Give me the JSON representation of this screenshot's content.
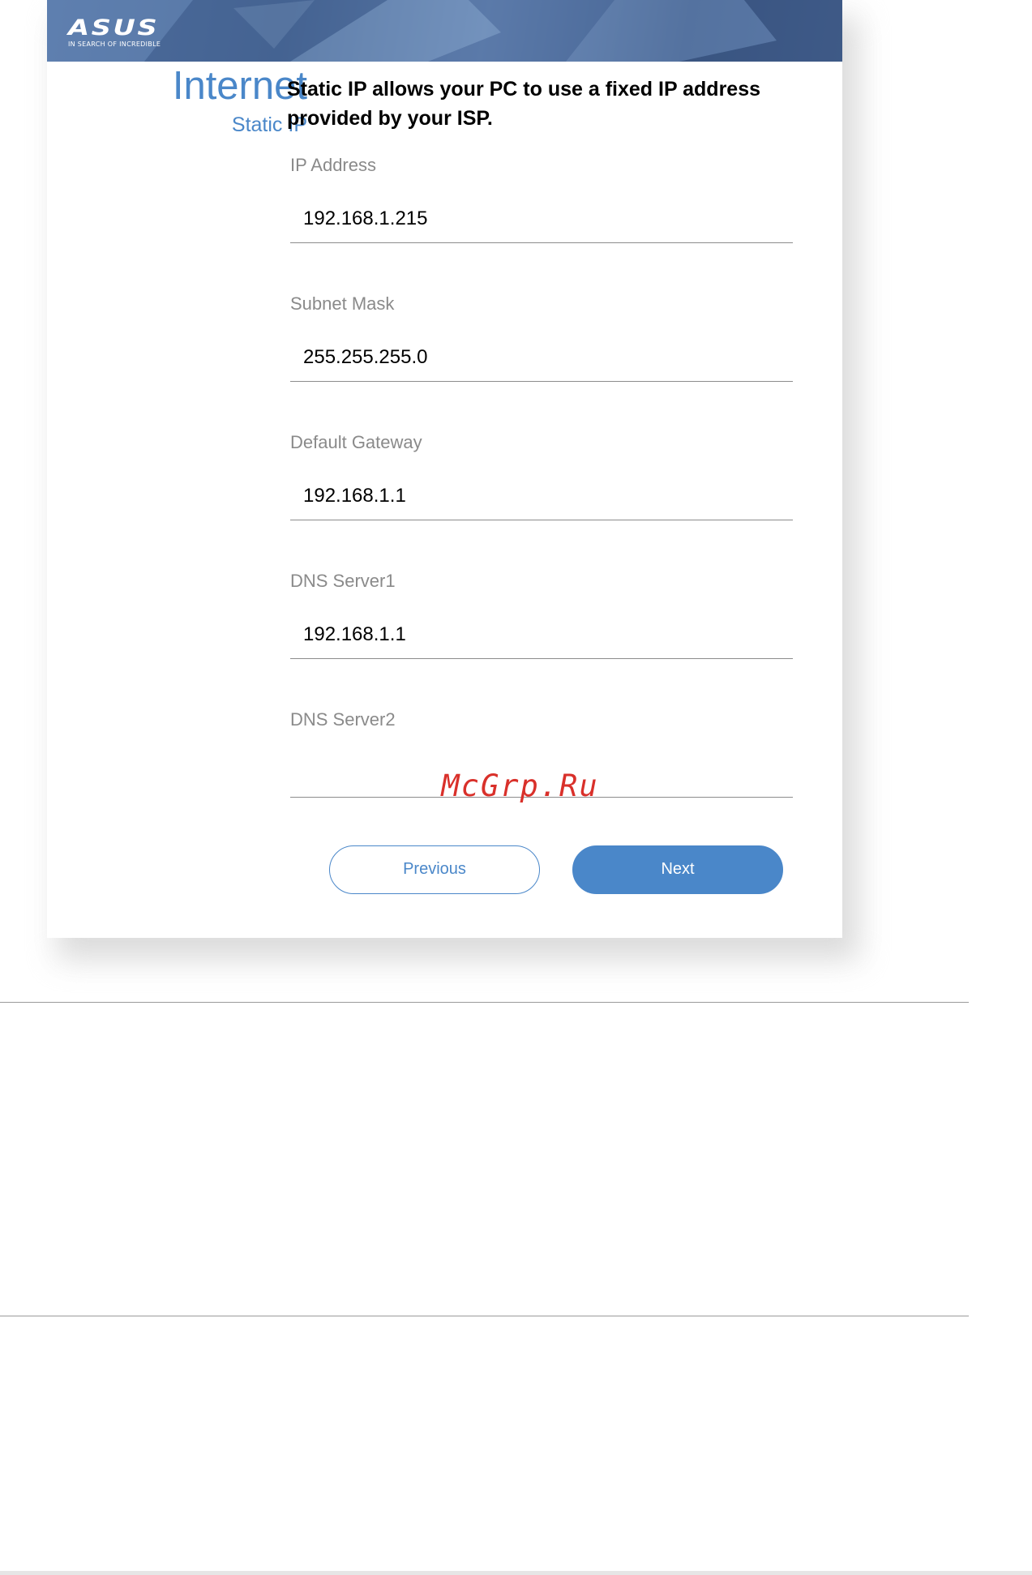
{
  "banner": {
    "logo_text": "ASUS",
    "logo_tagline": "IN SEARCH OF INCREDIBLE",
    "background_color": "#4b6a98"
  },
  "sidebar": {
    "title": "Internet",
    "subtitle": "Static IP"
  },
  "main": {
    "description": "Static IP allows your PC to use a fixed IP address provided by your ISP.",
    "fields": [
      {
        "label": "IP Address",
        "value": "192.168.1.215",
        "placeholder": ""
      },
      {
        "label": "Subnet Mask",
        "value": "255.255.255.0",
        "placeholder": ""
      },
      {
        "label": "Default Gateway",
        "value": "192.168.1.1",
        "placeholder": ""
      },
      {
        "label": "DNS Server1",
        "value": "192.168.1.1",
        "placeholder": ""
      },
      {
        "label": "DNS Server2",
        "value": "",
        "placeholder": ""
      }
    ]
  },
  "buttons": {
    "previous_label": "Previous",
    "next_label": "Next"
  },
  "watermark": {
    "text": "McGrp.Ru",
    "color": "#d9302a"
  },
  "colors": {
    "accent": "#4a87c9",
    "label_gray": "#8a8a8a"
  }
}
